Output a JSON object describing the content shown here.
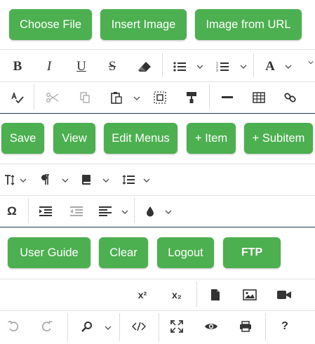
{
  "top_buttons": {
    "choose_file": "Choose File",
    "insert_image": "Insert Image",
    "image_from_url": "Image from URL"
  },
  "menu_buttons": {
    "save": "Save",
    "view": "View",
    "edit_menus": "Edit Menus",
    "item": "+ Item",
    "subitem": "+ Subitem"
  },
  "bottom_buttons": {
    "user_guide": "User Guide",
    "clear": "Clear",
    "logout": "Logout",
    "ftp": "FTP"
  },
  "toolbar": {
    "bold": "B",
    "italic": "I",
    "underline": "U",
    "strike": "S",
    "font_color": "A",
    "omega": "Ω",
    "help": "?",
    "superscript": "x²",
    "subscript": "x₂"
  },
  "colors": {
    "button_green": "#4caf50",
    "separator_blue": "#1f3b57",
    "icon": "#333333"
  }
}
